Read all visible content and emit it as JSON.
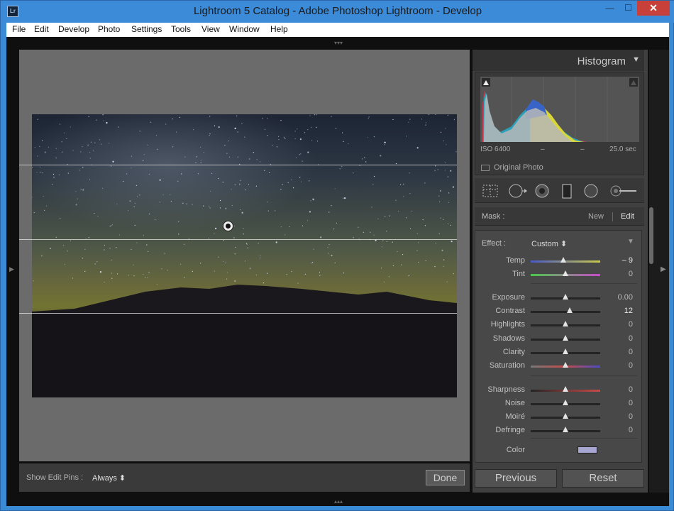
{
  "window": {
    "title": "Lightroom 5 Catalog - Adobe Photoshop Lightroom - Develop",
    "app_icon_text": "Lr",
    "minimize_glyph": "—",
    "maximize_glyph": "☐",
    "close_glyph": "✕"
  },
  "menu": [
    "File",
    "Edit",
    "Develop",
    "Photo",
    "Settings",
    "Tools",
    "View",
    "Window",
    "Help"
  ],
  "toolbar": {
    "show_edit_pins_label": "Show Edit Pins :",
    "show_edit_pins_value": "Always ⬍",
    "done_label": "Done"
  },
  "histogram": {
    "title": "Histogram",
    "iso": "ISO 6400",
    "dash1": "–",
    "dash2": "–",
    "shutter": "25.0 sec",
    "original_photo_label": "Original Photo"
  },
  "tools": [
    "crop-overlay-icon",
    "spot-removal-icon",
    "red-eye-icon",
    "graduated-filter-icon",
    "radial-filter-icon",
    "adjustment-brush-icon"
  ],
  "mask": {
    "label": "Mask :",
    "new_label": "New",
    "edit_label": "Edit"
  },
  "effect": {
    "label": "Effect :",
    "value": "Custom ⬍"
  },
  "sliders": [
    {
      "label": "Temp",
      "value": "– 9",
      "position": 0.47
    },
    {
      "label": "Tint",
      "value": "0",
      "position": 0.5
    },
    {
      "label": "Exposure",
      "value": "0.00",
      "position": 0.5
    },
    {
      "label": "Contrast",
      "value": "12",
      "position": 0.56
    },
    {
      "label": "Highlights",
      "value": "0",
      "position": 0.5
    },
    {
      "label": "Shadows",
      "value": "0",
      "position": 0.5
    },
    {
      "label": "Clarity",
      "value": "0",
      "position": 0.5
    },
    {
      "label": "Saturation",
      "value": "0",
      "position": 0.5
    },
    {
      "label": "Sharpness",
      "value": "0",
      "position": 0.5
    },
    {
      "label": "Noise",
      "value": "0",
      "position": 0.5
    },
    {
      "label": "Moiré",
      "value": "0",
      "position": 0.5
    },
    {
      "label": "Defringe",
      "value": "0",
      "position": 0.5
    }
  ],
  "color": {
    "label": "Color",
    "swatch": "#a7a6d2"
  },
  "buttons": {
    "previous": "Previous",
    "reset": "Reset"
  }
}
